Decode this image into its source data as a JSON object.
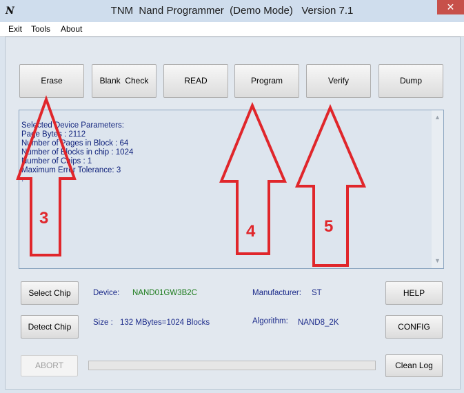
{
  "window": {
    "title": "TNM  Nand Programmer  (Demo Mode)   Version 7.1",
    "app_icon_glyph": "N",
    "close_glyph": "✕",
    "titlebar_color": "#cfdded",
    "close_color": "#c7504a"
  },
  "menu": {
    "items": [
      "Exit",
      "Tools",
      "About"
    ]
  },
  "toolbar": {
    "buttons": [
      "Erase",
      "Blank  Check",
      "READ",
      "Program",
      "Verify",
      "Dump"
    ]
  },
  "log": {
    "lines": [
      "Selected Device Parameters:",
      "Page Bytes : 2112",
      "Number of Pages in Block : 64",
      "Number of Blocks in chip : 1024",
      "Number of Chips : 1",
      "Maximum Error Tolerance: 3",
      "."
    ],
    "text_color": "#0d1f7a",
    "scroll_up_glyph": "▲",
    "scroll_down_glyph": "▼"
  },
  "device_info": {
    "device_label": "Device:",
    "device_value": "NAND01GW3B2C",
    "manufacturer_label": "Manufacturer:",
    "manufacturer_value": "ST",
    "size_label": "Size :",
    "size_value": "132 MBytes=1024 Blocks",
    "algorithm_label": "Algorithm:",
    "algorithm_value": "NAND8_2K",
    "device_value_color": "#1b7a1b"
  },
  "actions": {
    "select_chip": "Select Chip",
    "detect_chip": "Detect Chip",
    "help": "HELP",
    "config": "CONFIG",
    "abort": "ABORT",
    "clean_log": "Clean Log"
  },
  "progress": {
    "fraction": 0
  },
  "annotations": {
    "color": "#e0262b",
    "labels": [
      "3",
      "4",
      "5"
    ]
  }
}
